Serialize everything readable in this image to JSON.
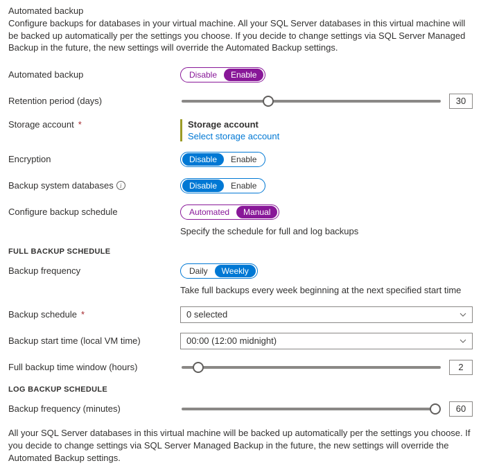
{
  "header": {
    "title": "Automated backup",
    "description": "Configure backups for databases in your virtual machine. All your SQL Server databases in this virtual machine will be backed up automatically per the settings you choose. If you decide to change settings via SQL Server Managed Backup in the future, the new settings will override the Automated Backup settings."
  },
  "fields": {
    "automated_backup": {
      "label": "Automated backup",
      "disable": "Disable",
      "enable": "Enable"
    },
    "retention": {
      "label": "Retention period (days)",
      "value": "30"
    },
    "storage": {
      "label": "Storage account",
      "title": "Storage account",
      "link": "Select storage account"
    },
    "encryption": {
      "label": "Encryption",
      "disable": "Disable",
      "enable": "Enable"
    },
    "backup_sys": {
      "label": "Backup system databases",
      "disable": "Disable",
      "enable": "Enable"
    },
    "schedule_cfg": {
      "label": "Configure backup schedule",
      "automated": "Automated",
      "manual": "Manual",
      "hint": "Specify the schedule for full and log backups"
    }
  },
  "full_schedule": {
    "header": "FULL BACKUP SCHEDULE",
    "frequency": {
      "label": "Backup frequency",
      "daily": "Daily",
      "weekly": "Weekly",
      "hint": "Take full backups every week beginning at the next specified start time"
    },
    "backup_schedule": {
      "label": "Backup schedule",
      "value": "0 selected"
    },
    "start_time": {
      "label": "Backup start time (local VM time)",
      "value": "00:00 (12:00 midnight)"
    },
    "window": {
      "label": "Full backup time window (hours)",
      "value": "2"
    }
  },
  "log_schedule": {
    "header": "LOG BACKUP SCHEDULE",
    "frequency": {
      "label": "Backup frequency (minutes)",
      "value": "60"
    }
  },
  "footer": "All your SQL Server databases in this virtual machine will be backed up automatically per the settings you choose. If you decide to change settings via SQL Server Managed Backup in the future, the new settings will override the Automated Backup settings."
}
